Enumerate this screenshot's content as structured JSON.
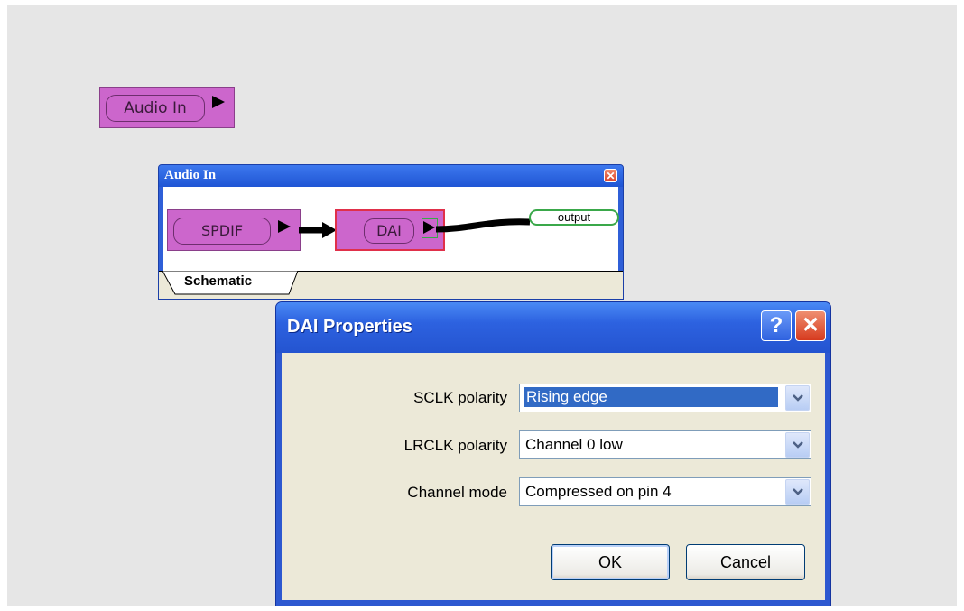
{
  "canvas": {
    "audio_in_node": {
      "label": "Audio In"
    }
  },
  "subwindow": {
    "title": "Audio In",
    "close_icon": "close-icon",
    "nodes": {
      "spdif": "SPDIF",
      "dai": "DAI",
      "output": "output"
    },
    "tabs": [
      {
        "label": "Schematic",
        "active": true
      }
    ]
  },
  "dialog": {
    "title": "DAI Properties",
    "help_label": "?",
    "close_label": "✕",
    "fields": [
      {
        "label": "SCLK polarity",
        "value": "Rising edge",
        "focused": true
      },
      {
        "label": "LRCLK polarity",
        "value": "Channel 0 low",
        "focused": false
      },
      {
        "label": "Channel mode",
        "value": "Compressed on pin 4",
        "focused": false
      }
    ],
    "ok_label": "OK",
    "cancel_label": "Cancel"
  },
  "colors": {
    "node_fill": "#cc66cc",
    "titlebar_blue": "#2d58d0",
    "dialog_face": "#ece9d8",
    "selection": "#316ac5"
  }
}
